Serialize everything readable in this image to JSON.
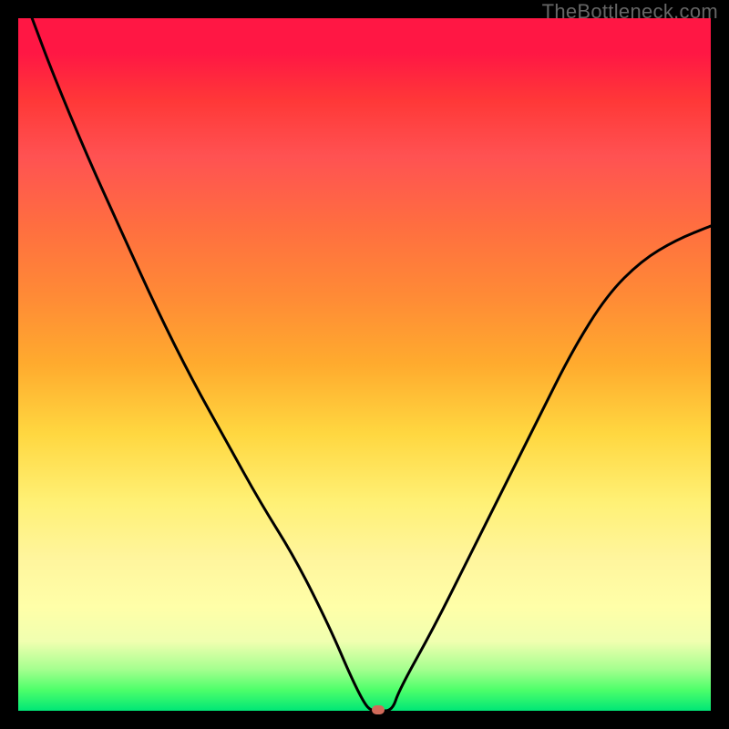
{
  "watermark": "TheBottleneck.com",
  "chart_data": {
    "type": "line",
    "title": "",
    "xlabel": "",
    "ylabel": "",
    "xlim": [
      0,
      100
    ],
    "ylim": [
      0,
      100
    ],
    "series": [
      {
        "name": "bottleneck-curve",
        "x": [
          2,
          5,
          10,
          15,
          20,
          25,
          30,
          35,
          40,
          45,
          48,
          50,
          51,
          52,
          54,
          55,
          60,
          65,
          70,
          75,
          80,
          85,
          90,
          95,
          100
        ],
        "y": [
          100,
          92,
          80,
          69,
          58,
          48,
          39,
          30,
          22,
          12,
          5,
          1,
          0,
          0,
          0,
          3,
          12,
          22,
          32,
          42,
          52,
          60,
          65,
          68,
          70
        ]
      }
    ],
    "marker": {
      "x": 52,
      "y": 0,
      "color": "#d16a5a"
    },
    "gradient_stops": [
      {
        "pos": 0,
        "color": "#ff1744"
      },
      {
        "pos": 50,
        "color": "#ffd740"
      },
      {
        "pos": 90,
        "color": "#f0ffb0"
      },
      {
        "pos": 100,
        "color": "#00e676"
      }
    ]
  }
}
